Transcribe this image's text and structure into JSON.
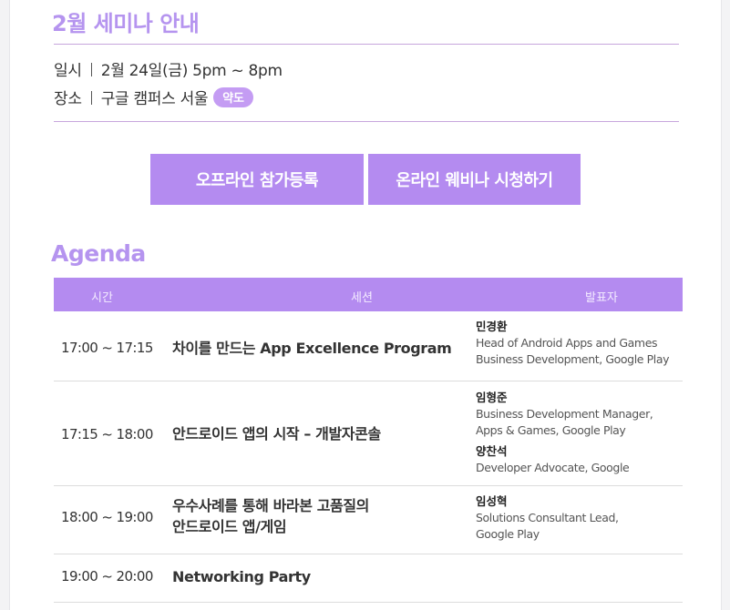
{
  "header": {
    "title": "2월 세미나 안내",
    "date_label": "일시",
    "date_value": "2월 24일(금) 5pm ~ 8pm",
    "place_label": "장소",
    "place_value": "구글 캠퍼스 서울",
    "map_badge": "약도"
  },
  "buttons": {
    "offline": "오프라인 참가등록",
    "online": "온라인 웨비나 시청하기"
  },
  "agenda": {
    "title": "Agenda",
    "columns": [
      "시간",
      "세션",
      "발표자"
    ],
    "rows": [
      {
        "time": "17:00 ~ 17:15",
        "session": [
          "차이를 만드는 App Excellence Program"
        ],
        "speakers": [
          {
            "name": "민경환",
            "role": [
              "Head of Android Apps and Games",
              "Business Development, Google Play"
            ]
          }
        ]
      },
      {
        "time": "17:15 ~ 18:00",
        "session": [
          "안드로이드 앱의 시작 – 개발자콘솔"
        ],
        "speakers": [
          {
            "name": "임형준",
            "role": [
              "Business Development Manager,",
              "Apps & Games, Google Play"
            ]
          },
          {
            "name": "양찬석",
            "role": [
              "Developer Advocate, Google"
            ]
          }
        ]
      },
      {
        "time": "18:00 ~ 19:00",
        "session": [
          "우수사례를 통해 바라본 고품질의",
          "안드로이드 앱/게임"
        ],
        "speakers": [
          {
            "name": "임성혁",
            "role": [
              "Solutions Consultant Lead,",
              "Google Play"
            ]
          }
        ]
      },
      {
        "time": "19:00 ~ 20:00",
        "session": [
          "Networking Party"
        ],
        "speakers": []
      }
    ]
  },
  "colors": {
    "accent": "#b48bf0",
    "title": "#b594ef",
    "badge": "#c49cf3"
  }
}
